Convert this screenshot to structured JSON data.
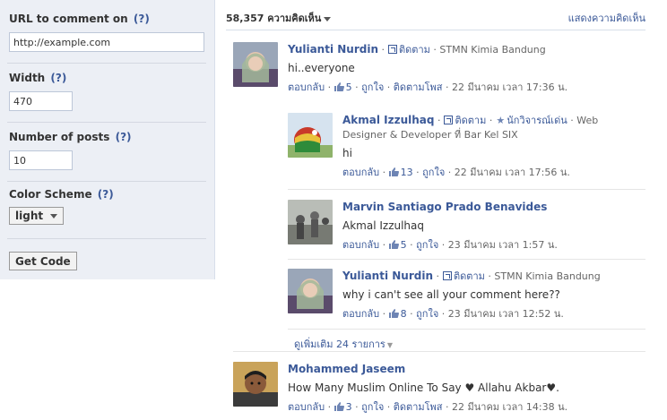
{
  "settings": {
    "url_label": "URL to comment on",
    "url_value": "http://example.com",
    "width_label": "Width",
    "width_value": "470",
    "posts_label": "Number of posts",
    "posts_value": "10",
    "color_label": "Color Scheme",
    "color_value": "light",
    "help": "(?)",
    "get_code": "Get Code"
  },
  "header": {
    "count": "58,357 ความคิดเห็น",
    "show_comments": "แสดงความคิดเห็น"
  },
  "actions": {
    "reply": "ตอบกลับ",
    "like": "ถูกใจ",
    "follow": "ติดตาม",
    "follow_post": "ติดตามโพส"
  },
  "comments": [
    {
      "name": "Yulianti Nurdin",
      "affiliation": "STMN Kimia Bandung",
      "text": "hi..everyone",
      "likes": "5",
      "time": "22 มีนาคม เวลา 17:36 น."
    },
    {
      "name": "Akmal Izzulhaq",
      "badge": "นักวิจารณ์เด่น",
      "affiliation_a": "Web",
      "affiliation_b": "Designer & Developer ที่ Bar Kel SIX",
      "text": "hi",
      "likes": "13",
      "time": "22 มีนาคม เวลา 17:56 น."
    },
    {
      "name": "Marvin Santiago Prado Benavides",
      "text": "Akmal Izzulhaq",
      "likes": "5",
      "time": "23 มีนาคม เวลา 1:57 น."
    },
    {
      "name": "Yulianti Nurdin",
      "affiliation": "STMN Kimia Bandung",
      "text": "why i can't see all your comment here??",
      "likes": "8",
      "time": "23 มีนาคม เวลา 12:52 น."
    },
    {
      "name": "Mohammed Jaseem",
      "text": "How Many Muslim Online To Say ♥ Allahu Akbar♥.",
      "likes": "3",
      "time": "22 มีนาคม เวลา 14:38 น."
    }
  ],
  "more_replies": "ดูเพิ่มเติม 24 รายการ"
}
